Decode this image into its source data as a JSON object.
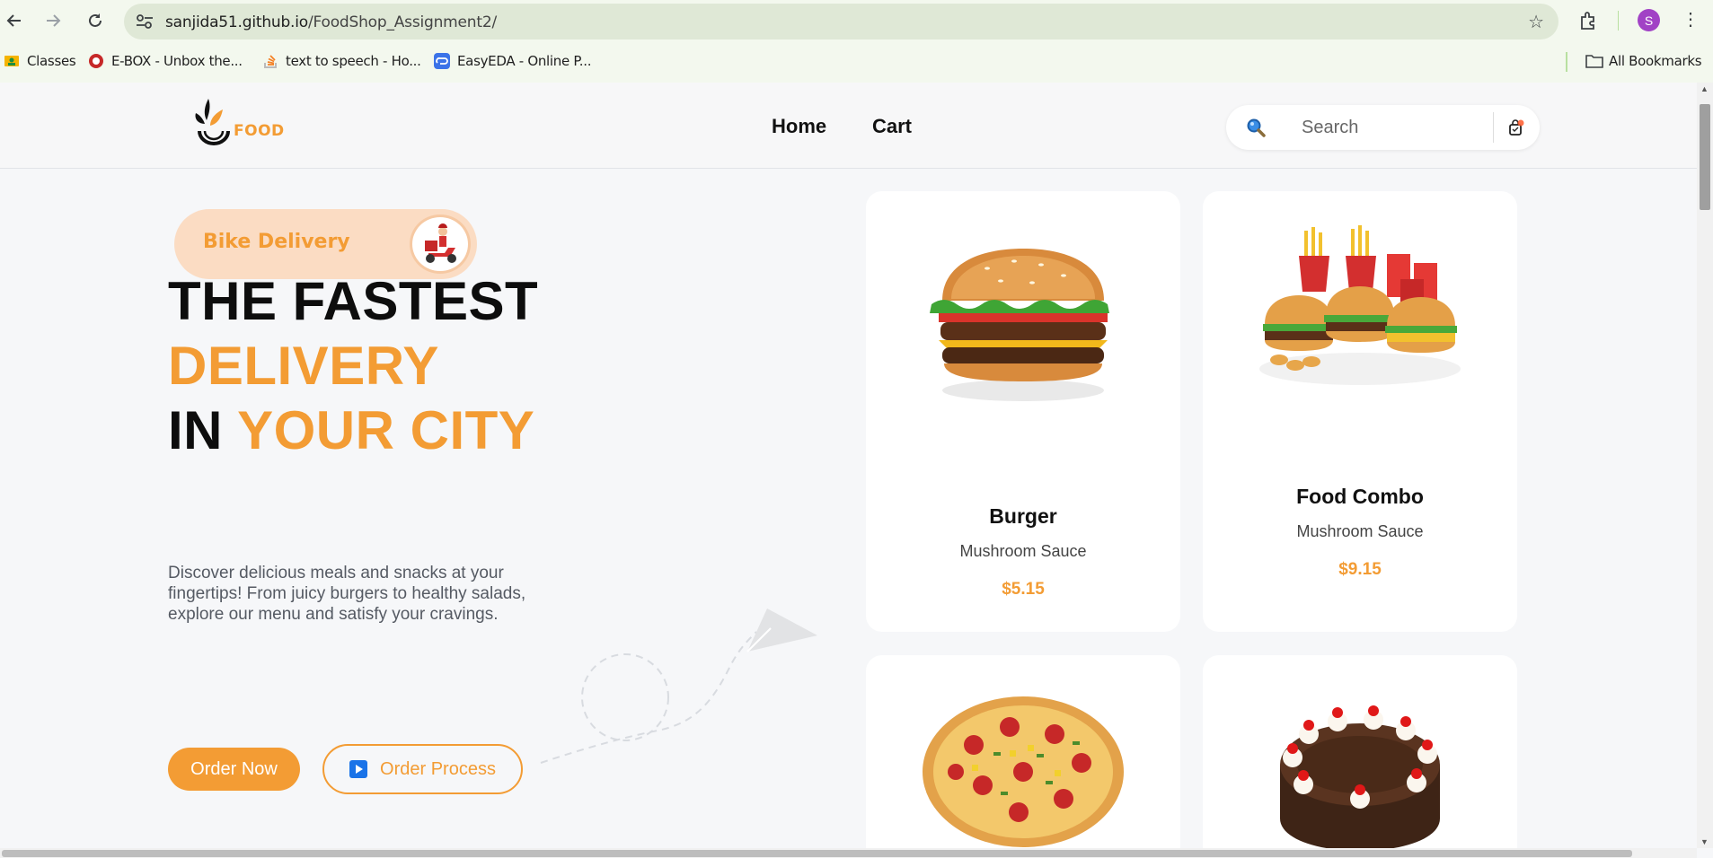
{
  "browser": {
    "url_host": "sanjida51.github.io",
    "url_path": "/FoodShop_Assignment2/",
    "profile_initial": "S",
    "bookmarks": [
      {
        "label": "Classes",
        "icon": "classroom-icon"
      },
      {
        "label": "E-BOX - Unbox the...",
        "icon": "ebox-icon"
      },
      {
        "label": "text to speech - Ho...",
        "icon": "stack-overflow-icon"
      },
      {
        "label": "EasyEDA - Online P...",
        "icon": "easyeda-icon"
      }
    ],
    "all_bookmarks": "All Bookmarks"
  },
  "header": {
    "logo_text": "FOOD",
    "nav": [
      {
        "label": "Home"
      },
      {
        "label": "Cart"
      }
    ],
    "search_placeholder": "Search"
  },
  "hero": {
    "badge": "Bike Delivery",
    "line1": "THE FASTEST",
    "line2": "DELIVERY",
    "line3_a": "IN ",
    "line3_b": "YOUR CITY",
    "description": "Discover delicious meals and snacks at your fingertips! From juicy burgers to healthy salads, explore our menu and satisfy your cravings.",
    "primary_button": "Order Now",
    "secondary_button": "Order Process"
  },
  "products": [
    {
      "name": "Burger",
      "subtitle": "Mushroom Sauce",
      "price": "$5.15",
      "icon": "burger-image"
    },
    {
      "name": "Food Combo",
      "subtitle": "Mushroom Sauce",
      "price": "$9.15",
      "icon": "food-combo-image"
    },
    {
      "name": "",
      "subtitle": "",
      "price": "",
      "icon": "pizza-image"
    },
    {
      "name": "",
      "subtitle": "",
      "price": "",
      "icon": "cake-image"
    }
  ],
  "colors": {
    "accent": "#f39c34",
    "badge_bg": "#fbdcc3",
    "page_bg": "#f6f7f9"
  }
}
